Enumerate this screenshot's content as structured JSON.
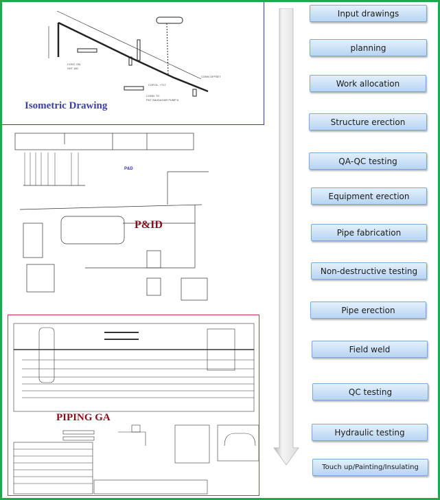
{
  "panels": {
    "isometric": {
      "title": "Isometric Drawing"
    },
    "pid": {
      "title": "P&ID",
      "inner_label": "P&D"
    },
    "piping_ga": {
      "title": "PIPING GA"
    }
  },
  "flow": {
    "direction_icon": "down-arrow",
    "steps": [
      {
        "label": "Input drawings"
      },
      {
        "label": "planning"
      },
      {
        "label": "Work allocation"
      },
      {
        "label": "Structure erection"
      },
      {
        "label": "QA-QC  testing"
      },
      {
        "label": "Equipment erection"
      },
      {
        "label": "Pipe fabrication"
      },
      {
        "label": "Non-destructive testing"
      },
      {
        "label": "Pipe erection"
      },
      {
        "label": "Field weld"
      },
      {
        "label": "QC testing"
      },
      {
        "label": "Hydraulic testing"
      },
      {
        "label": "Touch up/Painting/Insulating"
      }
    ]
  },
  "colors": {
    "frame": "#22a84a",
    "step_fill_top": "#e4f0fc",
    "step_fill_bottom": "#b8d5f2",
    "iso_title": "#3b3fa3",
    "drawing_title": "#8b0a1a"
  }
}
